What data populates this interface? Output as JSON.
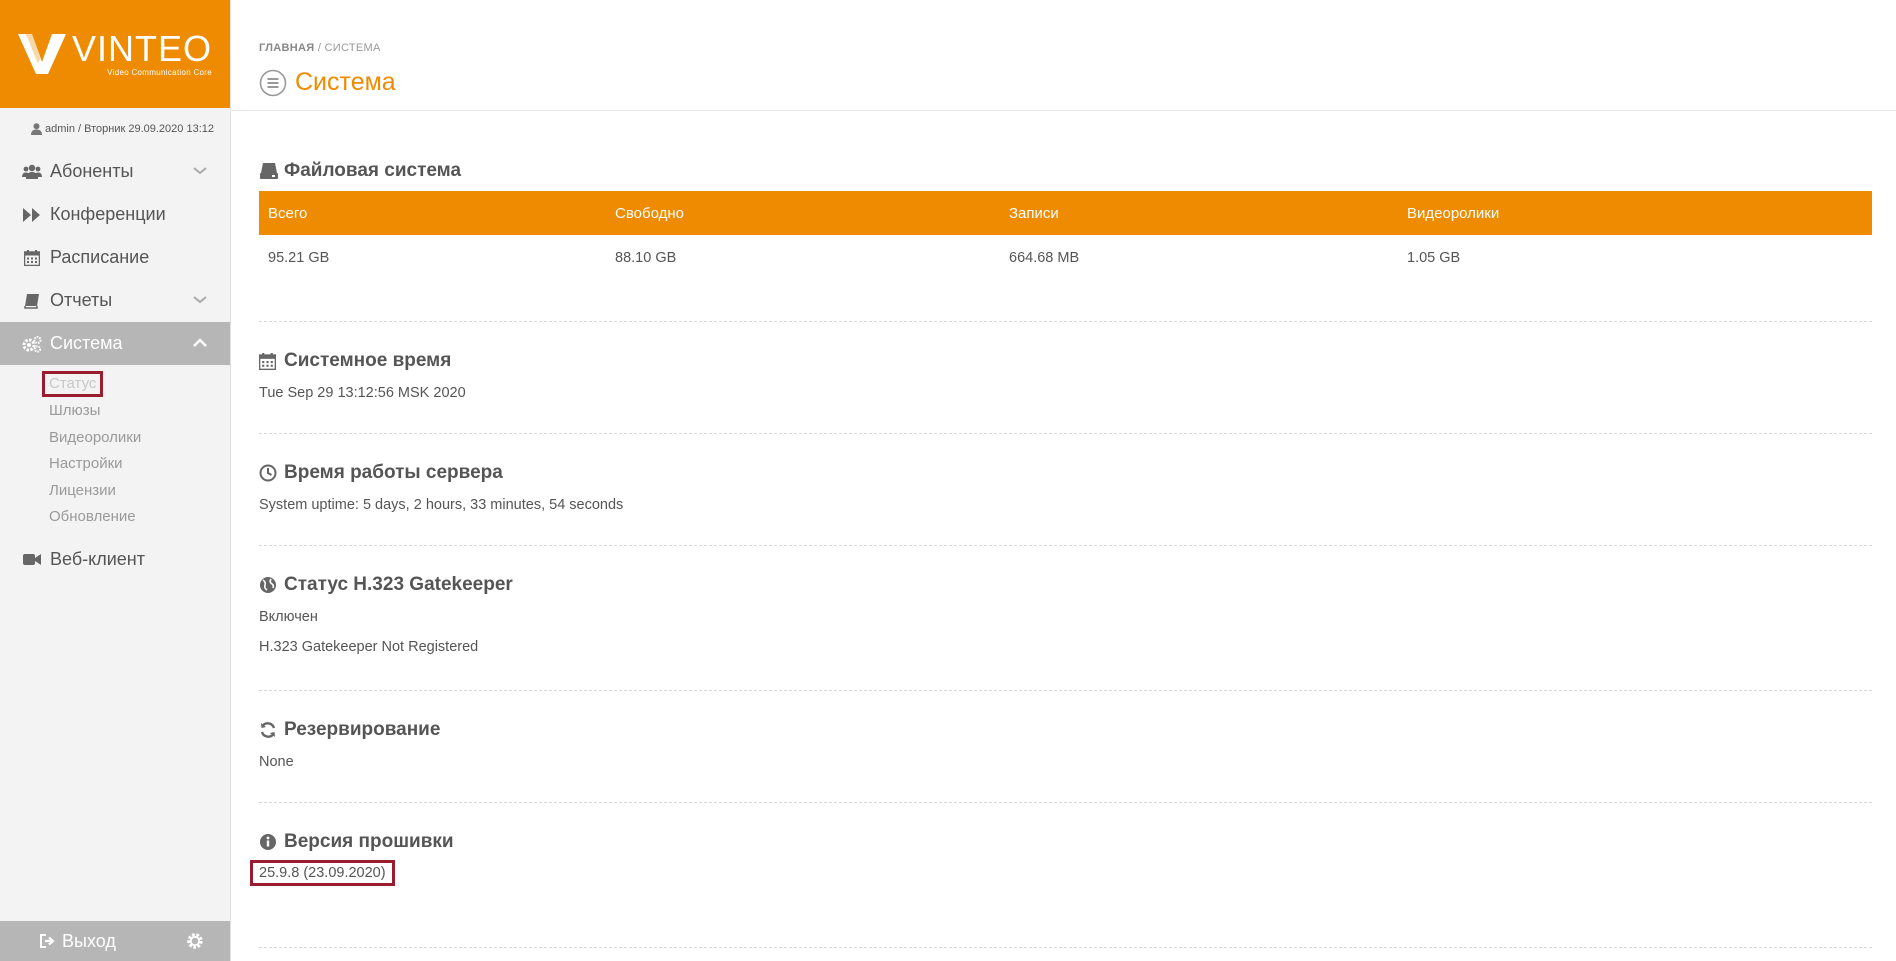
{
  "logo": {
    "name": "VINTEO",
    "subtitle": "Video Communication Core"
  },
  "user": {
    "line": "admin / Вторник 29.09.2020 13:12"
  },
  "nav": [
    {
      "label": "Абоненты",
      "icon": "users-icon",
      "expandable": true
    },
    {
      "label": "Конференции",
      "icon": "forward-icon",
      "expandable": false
    },
    {
      "label": "Расписание",
      "icon": "calendar-icon",
      "expandable": false
    },
    {
      "label": "Отчеты",
      "icon": "book-icon",
      "expandable": true
    },
    {
      "label": "Система",
      "icon": "cogs-icon",
      "expandable": true,
      "active": true
    },
    {
      "label": "Веб-клиент",
      "icon": "video-camera-icon",
      "expandable": false
    }
  ],
  "subnav": [
    {
      "label": "Статус",
      "active": true
    },
    {
      "label": "Шлюзы"
    },
    {
      "label": "Видеоролики"
    },
    {
      "label": "Настройки"
    },
    {
      "label": "Лицензии"
    },
    {
      "label": "Обновление"
    }
  ],
  "footer": {
    "logout": "Выход"
  },
  "breadcrumb": {
    "home": "ГЛАВНАЯ",
    "sep": "/",
    "current": "СИСТЕМА"
  },
  "page": {
    "title": "Система"
  },
  "filesystem": {
    "title": "Файловая система",
    "headers": [
      "Всего",
      "Свободно",
      "Записи",
      "Видеоролики"
    ],
    "values": [
      "95.21 GB",
      "88.10 GB",
      "664.68 MB",
      "1.05 GB"
    ]
  },
  "system_time": {
    "title": "Системное время",
    "value": "Tue Sep 29 13:12:56 MSK 2020"
  },
  "uptime": {
    "title": "Время работы сервера",
    "value": "System uptime: 5 days, 2 hours, 33 minutes, 54 seconds"
  },
  "gatekeeper": {
    "title": "Статус H.323 Gatekeeper",
    "state": "Включен",
    "status": "H.323 Gatekeeper Not Registered"
  },
  "redundancy": {
    "title": "Резервирование",
    "value": "None"
  },
  "firmware": {
    "title": "Версия прошивки",
    "value": "25.9.8 (23.09.2020)"
  },
  "colors": {
    "accent": "#ef8b00",
    "highlight": "#9b1c2e",
    "sidebar_active": "#b6b6b6"
  }
}
